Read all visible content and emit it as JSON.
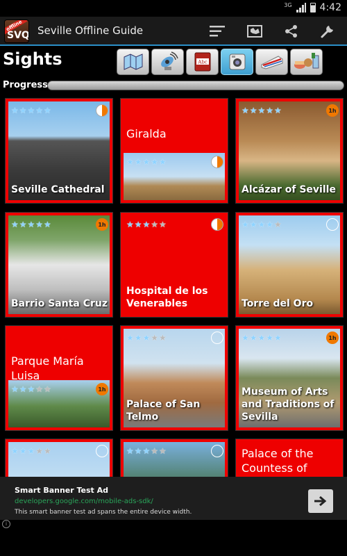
{
  "status_bar": {
    "signal": "3G",
    "time": "4:42"
  },
  "action_bar": {
    "app_icon_ribbon": "offline",
    "app_icon_abbr": "SVQ",
    "title": "Seville Offline Guide",
    "buttons": [
      "list-icon",
      "map-icon",
      "share-icon",
      "wrench-icon"
    ]
  },
  "header": {
    "title": "Sights"
  },
  "categories": [
    {
      "name": "tours",
      "icon": "folded-map-icon",
      "active": false
    },
    {
      "name": "audio",
      "icon": "satellite-dish-icon",
      "active": false
    },
    {
      "name": "phrasebook",
      "icon": "abc-book-icon",
      "active": false
    },
    {
      "name": "sights",
      "icon": "camera-icon",
      "active": true
    },
    {
      "name": "transport",
      "icon": "train-icon",
      "active": false
    },
    {
      "name": "food",
      "icon": "food-drink-icon",
      "active": false
    }
  ],
  "progress": {
    "label": "Progress",
    "value": 0.0
  },
  "tiles": [
    {
      "label": "Seville Cathedral",
      "rating": 5,
      "badge": "pie",
      "badge_text": ""
    },
    {
      "label": "Giralda",
      "rating": 5,
      "badge": "pie",
      "badge_text": ""
    },
    {
      "label": "Alcázar of Seville",
      "rating": 5,
      "badge": "time",
      "badge_text": "1h"
    },
    {
      "label": "Barrio Santa Cruz",
      "rating": 5,
      "badge": "time",
      "badge_text": "1h"
    },
    {
      "label": "Hospital de los Venerables",
      "rating": 3,
      "badge": "pie",
      "badge_text": ""
    },
    {
      "label": "Torre del Oro",
      "rating": 4,
      "badge": "clock",
      "badge_text": ""
    },
    {
      "label": "Parque María Luisa",
      "rating": 3,
      "badge": "time",
      "badge_text": "1h"
    },
    {
      "label": "Palace of San Telmo",
      "rating": 3,
      "badge": "clock",
      "badge_text": ""
    },
    {
      "label": "Museum of Arts and Traditions of Sevilla",
      "rating": 5,
      "badge": "time",
      "badge_text": "1h"
    },
    {
      "label": "",
      "rating": 3,
      "badge": "clock",
      "badge_text": ""
    },
    {
      "label": "",
      "rating": 3,
      "badge": "clock",
      "badge_text": ""
    },
    {
      "label": "Palace of the Countess of",
      "rating": 0,
      "badge": "none",
      "badge_text": ""
    }
  ],
  "ad": {
    "title": "Smart Banner Test Ad",
    "url": "developers.google.com/mobile-ads-sdk/",
    "description": "This smart banner test ad spans the entire device width.",
    "info": "i"
  },
  "colors": {
    "accent": "#2b8fc8",
    "tile_red": "#ee0000",
    "star_blue": "#8fd3ff",
    "badge_orange": "#f07800"
  }
}
